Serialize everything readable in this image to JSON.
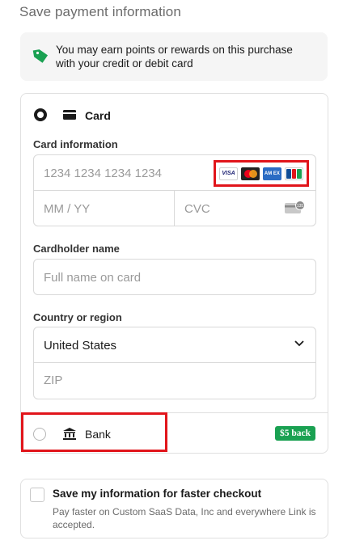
{
  "header": {
    "title": "Save payment information"
  },
  "rewards": {
    "text": "You may earn points or rewards on this purchase with your credit or debit card",
    "icon": "tag-icon",
    "icon_color": "#1aa152"
  },
  "card_option": {
    "label": "Card",
    "selected": true,
    "card_information_label": "Card information",
    "card_number_placeholder": "1234 1234 1234 1234",
    "brands": [
      "VISA",
      "Mastercard",
      "AMEX",
      "JCB"
    ],
    "expiry_placeholder": "MM / YY",
    "cvc_placeholder": "CVC",
    "cardholder_label": "Cardholder name",
    "cardholder_placeholder": "Full name on card",
    "country_label": "Country or region",
    "country_value": "United States",
    "zip_placeholder": "ZIP"
  },
  "bank_option": {
    "label": "Bank",
    "selected": false,
    "badge": "$5 back",
    "badge_color": "#1aa152"
  },
  "save_info": {
    "title": "Save my information for faster checkout",
    "description": "Pay faster on Custom SaaS Data, Inc and everywhere Link is accepted.",
    "checked": false
  },
  "highlight_color": "#e1151b"
}
